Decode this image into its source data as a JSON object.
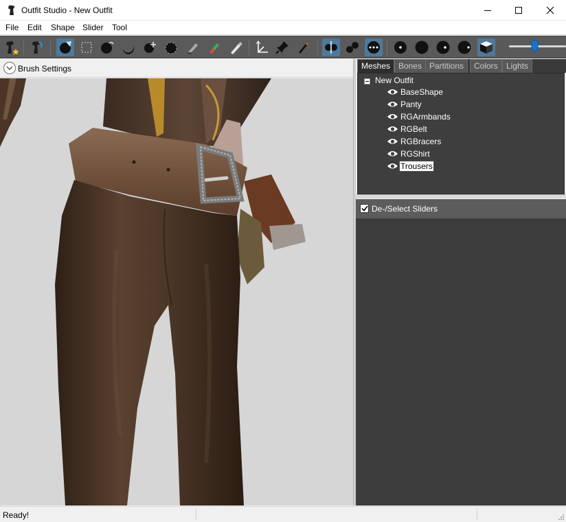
{
  "window": {
    "title": "Outfit Studio - New Outfit",
    "icon": "outfit-studio-icon",
    "controls": [
      "minimize-icon",
      "maximize-icon",
      "close-icon"
    ]
  },
  "menu": {
    "items": [
      "File",
      "Edit",
      "Shape",
      "Slider",
      "Tool"
    ]
  },
  "toolbar": {
    "icons": [
      "new-project-icon",
      "load-reference-icon",
      "select-brush-icon",
      "mask-brush-icon",
      "inflate-brush-icon",
      "deflate-brush-icon",
      "move-brush-icon",
      "smooth-brush-icon",
      "undiff-brush-icon",
      "weight-brush-icon",
      "color-brush-icon",
      "alpha-brush-icon",
      "transform-icon",
      "pivot-icon",
      "vertex-edit-icon",
      "xmirror-icon",
      "connected-icon",
      "global-brush-icon",
      "brush-size-1-icon",
      "brush-size-2-icon",
      "brush-size-3-icon",
      "brush-size-4-icon",
      "wireframe-icon"
    ],
    "brush_size_level": 0.45,
    "accent": "#4c7a9c"
  },
  "left_panel": {
    "brush_settings_label": "Brush Settings",
    "viewport_bg": "#d6d6d6"
  },
  "right_panel": {
    "tabs": [
      "Meshes",
      "Bones",
      "Partitions",
      "Colors",
      "Lights"
    ],
    "active_tab": "Meshes",
    "tree": {
      "root": "New Outfit",
      "items": [
        "BaseShape",
        "Panty",
        "RGArmbands",
        "RGBelt",
        "RGBracers",
        "RGShirt",
        "Trousers"
      ],
      "selected": "Trousers"
    },
    "sliders_header": "De-/Select Sliders",
    "sliders_checked": true
  },
  "status": {
    "text": "Ready!"
  }
}
